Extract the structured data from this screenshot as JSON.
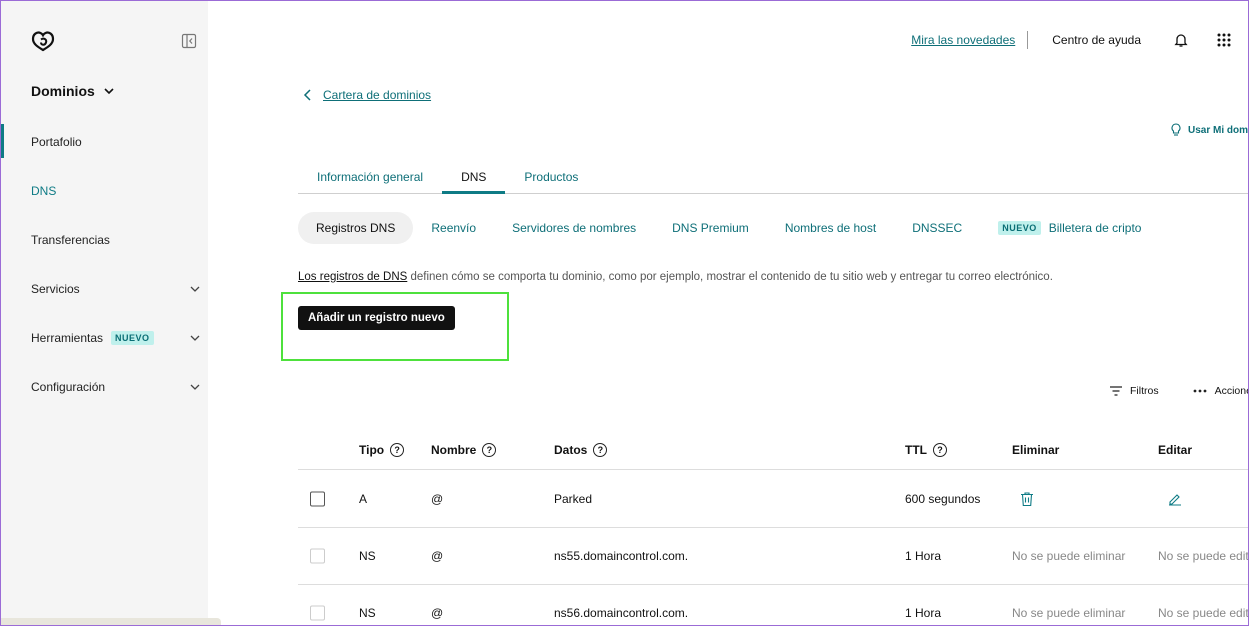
{
  "sidebar": {
    "title": "Dominios",
    "items": [
      {
        "label": "Portafolio"
      },
      {
        "label": "DNS"
      },
      {
        "label": "Transferencias"
      },
      {
        "label": "Servicios"
      },
      {
        "label": "Herramientas",
        "badge": "NUEVO"
      },
      {
        "label": "Configuración"
      }
    ]
  },
  "header": {
    "news_link": "Mira las novedades",
    "help": "Centro de ayuda"
  },
  "breadcrumb": "Cartera de dominios",
  "hint": "Usar Mi dom",
  "tabs": [
    "Información general",
    "DNS",
    "Productos"
  ],
  "subtabs": [
    "Registros DNS",
    "Reenvío",
    "Servidores de nombres",
    "DNS Premium",
    "Nombres de host",
    "DNSSEC",
    "Billetera de cripto"
  ],
  "subtab_badge": "NUEVO",
  "description": {
    "link": "Los registros de DNS",
    "text": " definen cómo se comporta tu dominio, como por ejemplo, mostrar el contenido de tu sitio web y entregar tu correo electrónico."
  },
  "add_button": "Añadir un registro nuevo",
  "tools": {
    "filters": "Filtros",
    "actions": "Accione"
  },
  "table": {
    "headers": {
      "type": "Tipo",
      "name": "Nombre",
      "data": "Datos",
      "ttl": "TTL",
      "delete": "Eliminar",
      "edit": "Editar"
    },
    "rows": [
      {
        "type": "A",
        "name": "@",
        "data": "Parked",
        "ttl": "600 segundos",
        "delete": "",
        "edit": ""
      },
      {
        "type": "NS",
        "name": "@",
        "data": "ns55.domaincontrol.com.",
        "ttl": "1 Hora",
        "delete": "No se puede eliminar",
        "edit": "No se puede edit"
      },
      {
        "type": "NS",
        "name": "@",
        "data": "ns56.domaincontrol.com.",
        "ttl": "1 Hora",
        "delete": "No se puede eliminar",
        "edit": "No se puede edit"
      }
    ]
  },
  "colors": {
    "accent": "#0e7b85",
    "highlight": "#4ee13c"
  }
}
